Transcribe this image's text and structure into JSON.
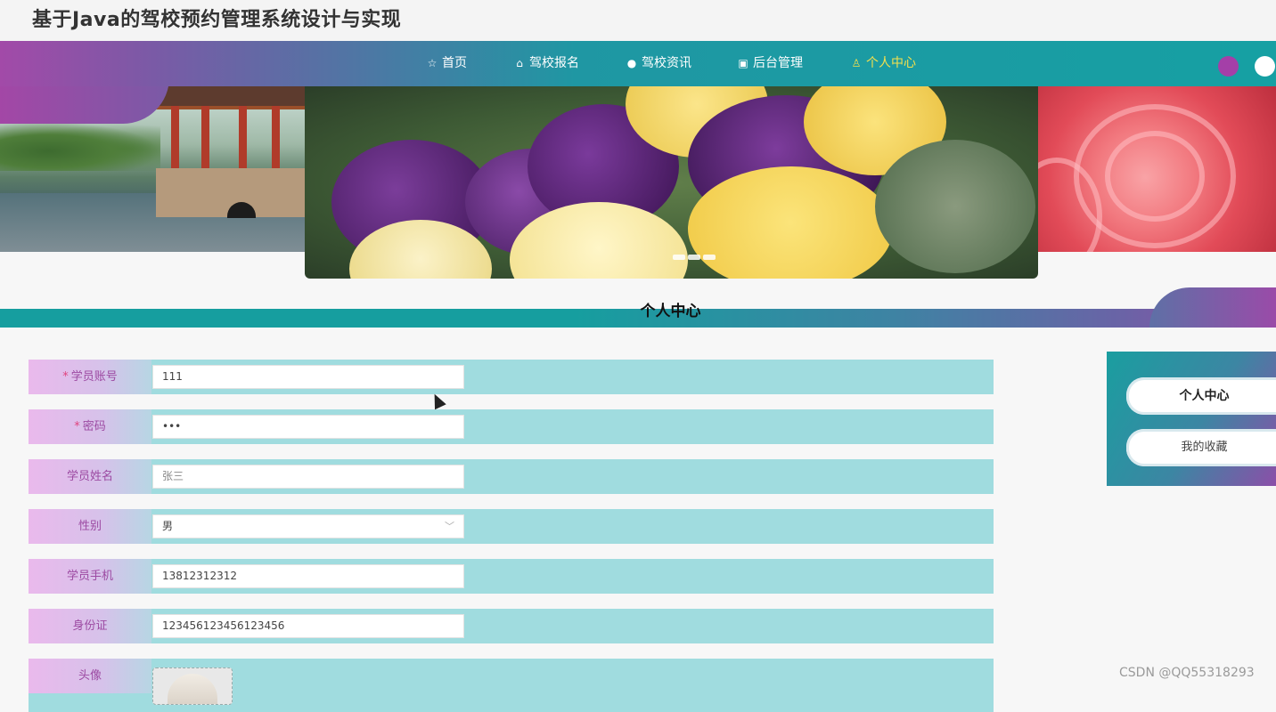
{
  "site": {
    "title": "基于Java的驾校预约管理系统设计与实现"
  },
  "nav": {
    "items": [
      {
        "label": "首页",
        "icon": "star-icon"
      },
      {
        "label": "驾校报名",
        "icon": "bag-icon"
      },
      {
        "label": "驾校资讯",
        "icon": "info-icon"
      },
      {
        "label": "后台管理",
        "icon": "briefcase-icon"
      },
      {
        "label": "个人中心",
        "icon": "user-icon",
        "active": true
      }
    ],
    "active_color": "#f4e04d"
  },
  "section": {
    "title": "个人中心"
  },
  "form": {
    "fields": [
      {
        "label": "学员账号",
        "required": true,
        "value": "111"
      },
      {
        "label": "密码",
        "required": true,
        "value": "•••"
      },
      {
        "label": "学员姓名",
        "required": false,
        "value": "张三"
      },
      {
        "label": "性别",
        "required": false,
        "value": "男",
        "type": "select"
      },
      {
        "label": "学员手机",
        "required": false,
        "value": "13812312312"
      },
      {
        "label": "身份证",
        "required": false,
        "value": "123456123456123456"
      },
      {
        "label": "头像",
        "required": false,
        "type": "image"
      }
    ],
    "required_mark": "*"
  },
  "side_menu": {
    "items": [
      {
        "label": "个人中心",
        "active": true
      },
      {
        "label": "我的收藏",
        "active": false
      }
    ]
  },
  "colors": {
    "nav_teal": "#16a0a3",
    "brand_purple": "#a24aa8",
    "row_bg": "#a0dcdf",
    "label_text": "#9c4aa2"
  },
  "watermark": "CSDN @QQ55318293"
}
